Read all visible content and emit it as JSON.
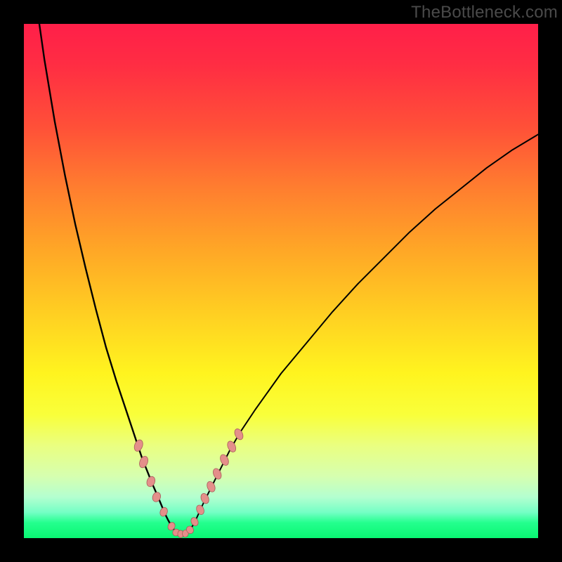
{
  "watermark": {
    "text": "TheBottleneck.com"
  },
  "colors": {
    "curve_stroke": "#000000",
    "marker_fill": "#e48f8a",
    "marker_stroke": "#a75e5a"
  },
  "chart_data": {
    "type": "line",
    "title": "",
    "xlabel": "",
    "ylabel": "",
    "xlim": [
      0,
      100
    ],
    "ylim": [
      0,
      100
    ],
    "series": [
      {
        "name": "left-branch",
        "x": [
          3,
          4,
          6,
          8,
          10,
          12,
          14,
          16,
          18,
          20,
          22,
          23,
          24,
          25,
          26,
          26.5,
          27,
          27.5,
          28,
          28.5,
          29,
          29.5
        ],
        "y": [
          100,
          93,
          81,
          70.5,
          61,
          52.5,
          44.5,
          37,
          30.5,
          24.5,
          18.5,
          15.5,
          13,
          10.5,
          8.2,
          7,
          5.8,
          4.6,
          3.6,
          2.7,
          1.9,
          1.3
        ]
      },
      {
        "name": "right-branch",
        "x": [
          32,
          32.5,
          33,
          33.5,
          34,
          35,
          36,
          38,
          40,
          42,
          45,
          50,
          55,
          60,
          65,
          70,
          75,
          80,
          85,
          90,
          95,
          100
        ],
        "y": [
          1.3,
          1.9,
          2.7,
          3.7,
          4.8,
          7,
          9,
          13,
          17,
          20.5,
          25,
          32,
          38,
          44,
          49.5,
          54.5,
          59.5,
          64,
          68,
          72,
          75.5,
          78.5
        ]
      },
      {
        "name": "valley-floor",
        "x": [
          29.5,
          30,
          30.5,
          31,
          31.5,
          32
        ],
        "y": [
          1.3,
          1.0,
          0.9,
          0.9,
          1.0,
          1.3
        ]
      }
    ],
    "markers": [
      {
        "x": 22.3,
        "y": 18.0,
        "rx": 5.5,
        "ry": 8.5,
        "rot": 22
      },
      {
        "x": 23.3,
        "y": 14.8,
        "rx": 5.5,
        "ry": 8.5,
        "rot": 22
      },
      {
        "x": 24.7,
        "y": 11.0,
        "rx": 5.5,
        "ry": 7.5,
        "rot": 22
      },
      {
        "x": 25.8,
        "y": 8.0,
        "rx": 5.5,
        "ry": 7.0,
        "rot": 22
      },
      {
        "x": 27.2,
        "y": 5.1,
        "rx": 5.0,
        "ry": 6.5,
        "rot": 25
      },
      {
        "x": 28.7,
        "y": 2.3,
        "rx": 4.8,
        "ry": 5.8,
        "rot": 30
      },
      {
        "x": 29.6,
        "y": 1.1,
        "rx": 4.8,
        "ry": 5.0,
        "rot": 45
      },
      {
        "x": 30.5,
        "y": 0.8,
        "rx": 5.2,
        "ry": 4.3,
        "rot": 85
      },
      {
        "x": 31.4,
        "y": 0.9,
        "rx": 5.2,
        "ry": 4.3,
        "rot": 95
      },
      {
        "x": 32.3,
        "y": 1.6,
        "rx": 4.8,
        "ry": 5.5,
        "rot": -35
      },
      {
        "x": 33.2,
        "y": 3.2,
        "rx": 4.8,
        "ry": 6.2,
        "rot": -28
      },
      {
        "x": 34.3,
        "y": 5.5,
        "rx": 5.0,
        "ry": 7.0,
        "rot": -25
      },
      {
        "x": 35.2,
        "y": 7.7,
        "rx": 5.2,
        "ry": 7.5,
        "rot": -24
      },
      {
        "x": 36.4,
        "y": 10.0,
        "rx": 5.2,
        "ry": 7.8,
        "rot": -24
      },
      {
        "x": 37.6,
        "y": 12.5,
        "rx": 5.2,
        "ry": 8.0,
        "rot": -24
      },
      {
        "x": 39.0,
        "y": 15.2,
        "rx": 5.2,
        "ry": 8.2,
        "rot": -25
      },
      {
        "x": 40.4,
        "y": 17.8,
        "rx": 5.2,
        "ry": 8.2,
        "rot": -26
      },
      {
        "x": 41.8,
        "y": 20.2,
        "rx": 5.2,
        "ry": 8.2,
        "rot": -27
      }
    ]
  }
}
